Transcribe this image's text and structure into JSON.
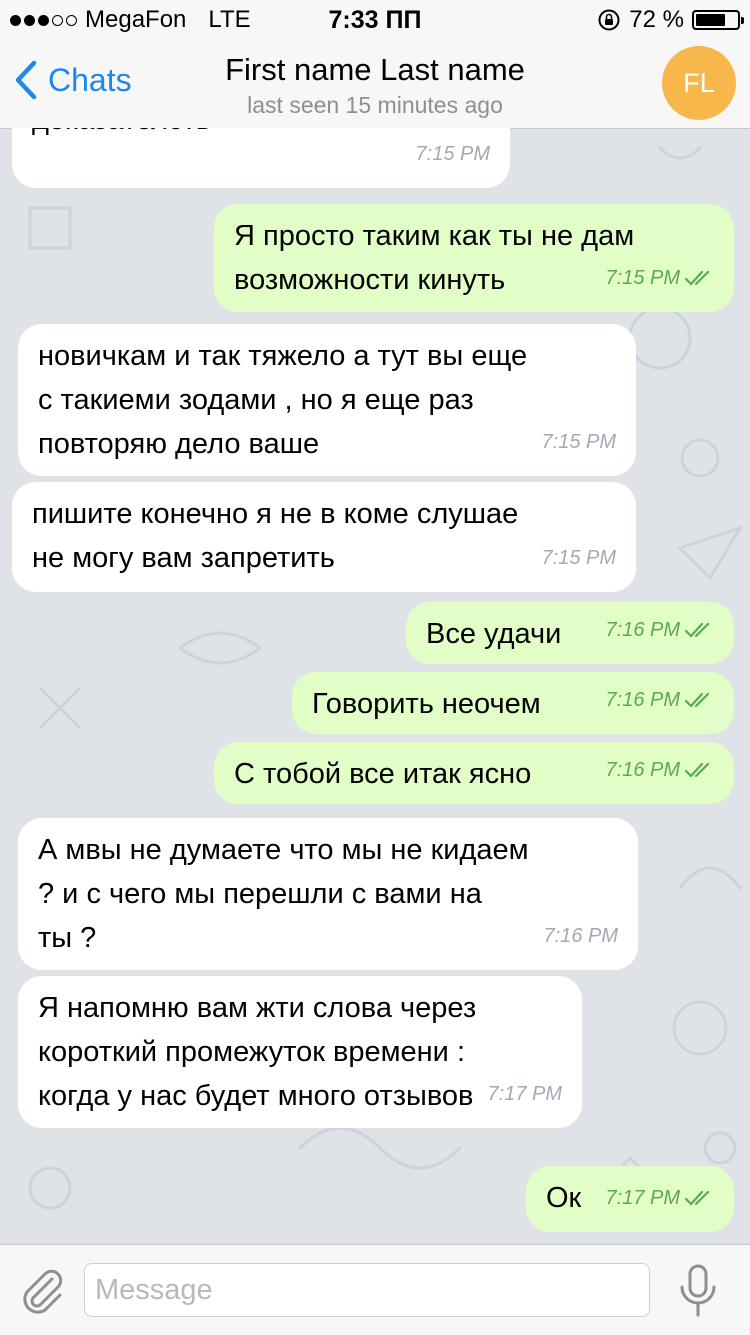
{
  "status_bar": {
    "carrier": "MegaFon",
    "network": "LTE",
    "time": "7:33 ПП",
    "battery": "72 %",
    "battery_level": 0.72,
    "icons": [
      "signal-dots-icon",
      "rotation-lock-icon",
      "battery-icon"
    ]
  },
  "header": {
    "back_label": "Chats",
    "title": "First name Last name",
    "subtitle": "last seen 15 minutes ago",
    "avatar_initials": "FL",
    "avatar_color": "#f7b74a"
  },
  "colors": {
    "accent": "#1f87ea",
    "incoming_bubble": "#ffffff",
    "outgoing_bubble": "#e1fec6",
    "read_check": "#5ca853",
    "chat_background": "#dfe3e8"
  },
  "messages": [
    {
      "direction": "in",
      "text": "доказателств",
      "time": "7:15 PM"
    },
    {
      "direction": "out",
      "text": "Я просто таким как ты не дам\nвозможности кинуть",
      "time": "7:15 PM",
      "read": true
    },
    {
      "direction": "in",
      "text": "новичкам и так тяжело а тут вы еще\nс такиеми зодами , но я еще раз\nповторяю дело ваше",
      "time": "7:15 PM"
    },
    {
      "direction": "in",
      "text": "пишите конечно я не в коме слушае\nне могу вам запретить",
      "time": "7:15 PM"
    },
    {
      "direction": "out",
      "text": "Все удачи",
      "time": "7:16 PM",
      "read": true
    },
    {
      "direction": "out",
      "text": "Говорить неочем",
      "time": "7:16 PM",
      "read": true
    },
    {
      "direction": "out",
      "text": "С тобой все итак ясно",
      "time": "7:16 PM",
      "read": true
    },
    {
      "direction": "in",
      "text": "А мвы не думаете что мы не кидаем\n? и с чего мы перешли с вами на\nты ?",
      "time": "7:16 PM"
    },
    {
      "direction": "in",
      "text": "Я напомню вам жти слова через\nкороткий промежуток времени :\nкогда у нас будет много отзывов",
      "time": "7:17 PM"
    },
    {
      "direction": "out",
      "text": "Ок",
      "time": "7:17 PM",
      "read": true
    }
  ],
  "composer": {
    "placeholder": "Message",
    "value": ""
  }
}
